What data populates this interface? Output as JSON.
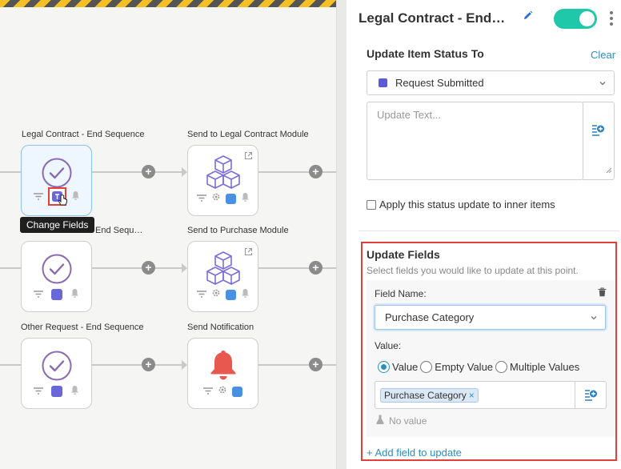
{
  "canvas": {
    "nodes": [
      {
        "title": "Legal Contract - End Sequence"
      },
      {
        "title": "Send to Legal Contract Module"
      },
      {
        "title": "End Sequ…"
      },
      {
        "title": "Send to Purchase Module"
      },
      {
        "title": "Other Request - End Sequence"
      },
      {
        "title": "Send Notification"
      }
    ],
    "tooltip": "Change Fields",
    "add_symbol": "+"
  },
  "panel": {
    "title": "Legal Contract - End…",
    "toggle_on": true,
    "status_section": {
      "title": "Update Item Status To",
      "clear_label": "Clear",
      "status_value": "Request Submitted",
      "status_color": "#5b5bd6",
      "update_text_placeholder": "Update Text...",
      "checkbox_label": "Apply this status update to inner items",
      "checkbox_checked": false
    },
    "update_fields": {
      "title": "Update Fields",
      "subtitle": "Select fields you would like to update at this point.",
      "field_name_label": "Field Name:",
      "field_name_value": "Purchase Category",
      "value_label": "Value:",
      "radio_options": [
        "Value",
        "Empty Value",
        "Multiple Values"
      ],
      "selected_option": "Value",
      "tag": "Purchase Category",
      "tag_remove": "×",
      "no_value_text": "No value",
      "add_field_label": "+ Add field to update"
    }
  },
  "colors": {
    "accent": "#2a8fbd",
    "toggle": "#1fc8a8",
    "highlight": "#e0413a",
    "node_purple": "#6a67d8",
    "node_blue": "#4a90e2",
    "bell_red": "#e8584f"
  }
}
